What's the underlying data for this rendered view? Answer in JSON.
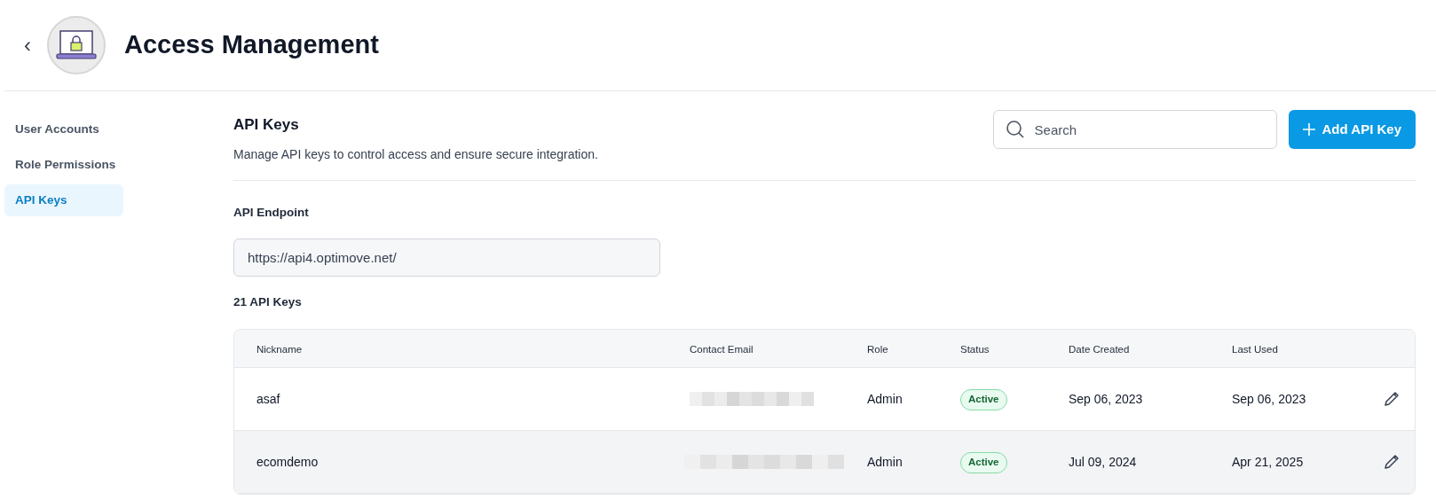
{
  "header": {
    "back": "‹",
    "title": "Access Management"
  },
  "sidebar": {
    "items": [
      {
        "label": "User Accounts",
        "selected": false
      },
      {
        "label": "Role Permissions",
        "selected": false
      },
      {
        "label": "API Keys",
        "selected": true
      }
    ]
  },
  "section": {
    "title": "API Keys",
    "description": "Manage API keys to control access and ensure secure integration.",
    "search": {
      "placeholder": "Search"
    },
    "add_button": "Add API Key"
  },
  "endpoint": {
    "label": "API Endpoint",
    "value": "https://api4.optimove.net/"
  },
  "count": "21 API Keys",
  "table": {
    "columns": [
      "Nickname",
      "Contact Email",
      "Role",
      "Status",
      "Date Created",
      "Last Used"
    ],
    "rows": [
      {
        "nickname": "asaf",
        "role": "Admin",
        "status": "Active",
        "created": "Sep 06, 2023",
        "last_used": "Sep 06, 2023",
        "highlighted": false
      },
      {
        "nickname": "ecomdemo",
        "role": "Admin",
        "status": "Active",
        "created": "Jul 09, 2024",
        "last_used": "Apr 21, 2025",
        "highlighted": true
      }
    ]
  }
}
